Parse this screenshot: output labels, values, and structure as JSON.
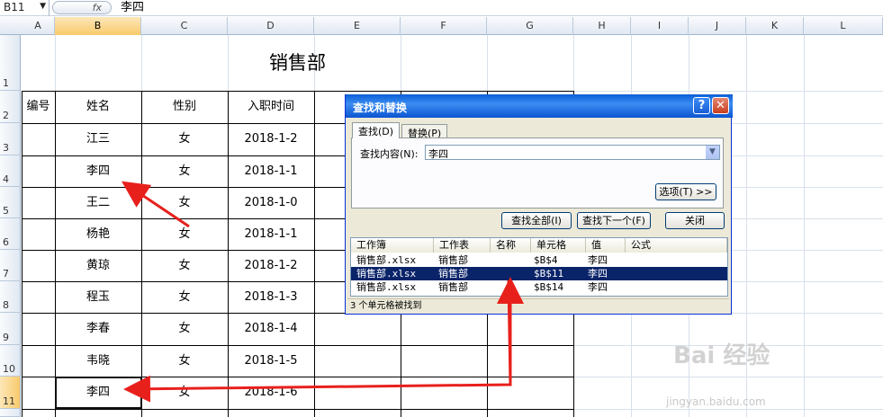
{
  "formula_bar": {
    "name_box": "B11",
    "fx_label": "fx",
    "value": "李四"
  },
  "columns": [
    "A",
    "B",
    "C",
    "D",
    "E",
    "F",
    "G",
    "H",
    "I",
    "J",
    "K",
    "L"
  ],
  "rows": [
    "1",
    "2",
    "3",
    "4",
    "5",
    "6",
    "7",
    "8",
    "9",
    "10",
    "11"
  ],
  "sheet": {
    "title": "销售部",
    "headers": [
      "编号",
      "姓名",
      "性别",
      "入职时间"
    ],
    "data": [
      {
        "name": "江三",
        "gender": "女",
        "date": "2018-1-2"
      },
      {
        "name": "李四",
        "gender": "女",
        "date": "2018-1-1"
      },
      {
        "name": "王二",
        "gender": "女",
        "date": "2018-1-0"
      },
      {
        "name": "杨艳",
        "gender": "女",
        "date": "2018-1-1"
      },
      {
        "name": "黄琼",
        "gender": "女",
        "date": "2018-1-2"
      },
      {
        "name": "程玉",
        "gender": "女",
        "date": "2018-1-3"
      },
      {
        "name": "李春",
        "gender": "女",
        "date": "2018-1-4"
      },
      {
        "name": "韦晓",
        "gender": "女",
        "date": "2018-1-5"
      },
      {
        "name": "李四",
        "gender": "女",
        "date": "2018-1-6"
      }
    ]
  },
  "dialog": {
    "title": "查找和替换",
    "help": "?",
    "close": "✕",
    "tab_find": "查找(D)",
    "tab_replace": "替换(P)",
    "find_label": "查找内容(N):",
    "find_value": "李四",
    "options_button": "选项(T) >>",
    "find_all_button": "查找全部(I)",
    "find_next_button": "查找下一个(F)",
    "close_button": "关闭",
    "result_headers": [
      "工作簿",
      "工作表",
      "名称",
      "单元格",
      "值",
      "公式"
    ],
    "results": [
      {
        "book": "销售部.xlsx",
        "sheet": "销售部",
        "name": "",
        "cell": "$B$4",
        "value": "李四",
        "formula": ""
      },
      {
        "book": "销售部.xlsx",
        "sheet": "销售部",
        "name": "",
        "cell": "$B$11",
        "value": "李四",
        "formula": ""
      },
      {
        "book": "销售部.xlsx",
        "sheet": "销售部",
        "name": "",
        "cell": "$B$14",
        "value": "李四",
        "formula": ""
      }
    ],
    "status": "3 个单元格被找到"
  },
  "watermark": {
    "logo": "Bai 经验",
    "url": "jingyan.baidu.com"
  },
  "colors": {
    "arrow": "#e8201c",
    "selection": "#0a246a",
    "title_bar": "#0a5ed7"
  }
}
